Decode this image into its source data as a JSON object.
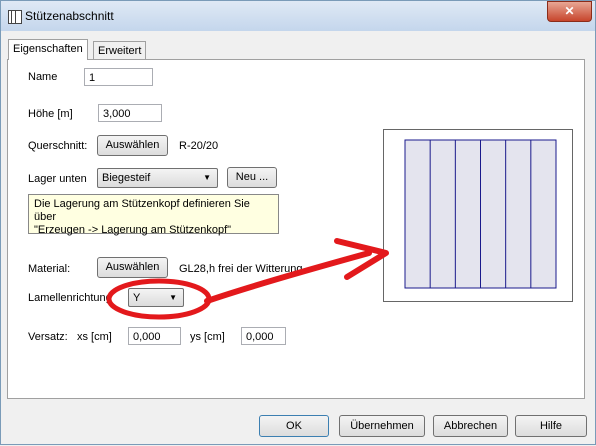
{
  "window": {
    "title": "Stützenabschnitt",
    "close_label": "✕"
  },
  "tabs": [
    {
      "label": "Eigenschaften"
    },
    {
      "label": "Erweitert"
    }
  ],
  "form": {
    "name_label": "Name",
    "name_value": "1",
    "hoehe_label": "Höhe [m]",
    "hoehe_value": "3,000",
    "querschnitt_label": "Querschnitt:",
    "querschnitt_button": "Auswählen",
    "querschnitt_value": "R-20/20",
    "lager_label": "Lager unten",
    "lager_value": "Biegesteif",
    "lager_new_button": "Neu ...",
    "info_text_line1": "Die Lagerung am Stützenkopf definieren Sie über",
    "info_text_line2": "\"Erzeugen -> Lagerung am Stützenkopf\"",
    "material_label": "Material:",
    "material_button": "Auswählen",
    "material_value": "GL28,h frei der Witterung",
    "lamellen_label": "Lamellenrichtung",
    "lamellen_value": "Y",
    "versatz_label": "Versatz:",
    "xs_label": "xs [cm]",
    "xs_value": "0,000",
    "ys_label": "ys [cm]",
    "ys_value": "0,000"
  },
  "buttons": {
    "ok": "OK",
    "apply": "Übernehmen",
    "cancel": "Abbrechen",
    "help": "Hilfe"
  },
  "colors": {
    "annotation": "#e3191c",
    "lamella_lines": "#1a1a8c",
    "preview_fill": "#e4e4ee"
  },
  "preview": {
    "lamella_count": 6
  }
}
